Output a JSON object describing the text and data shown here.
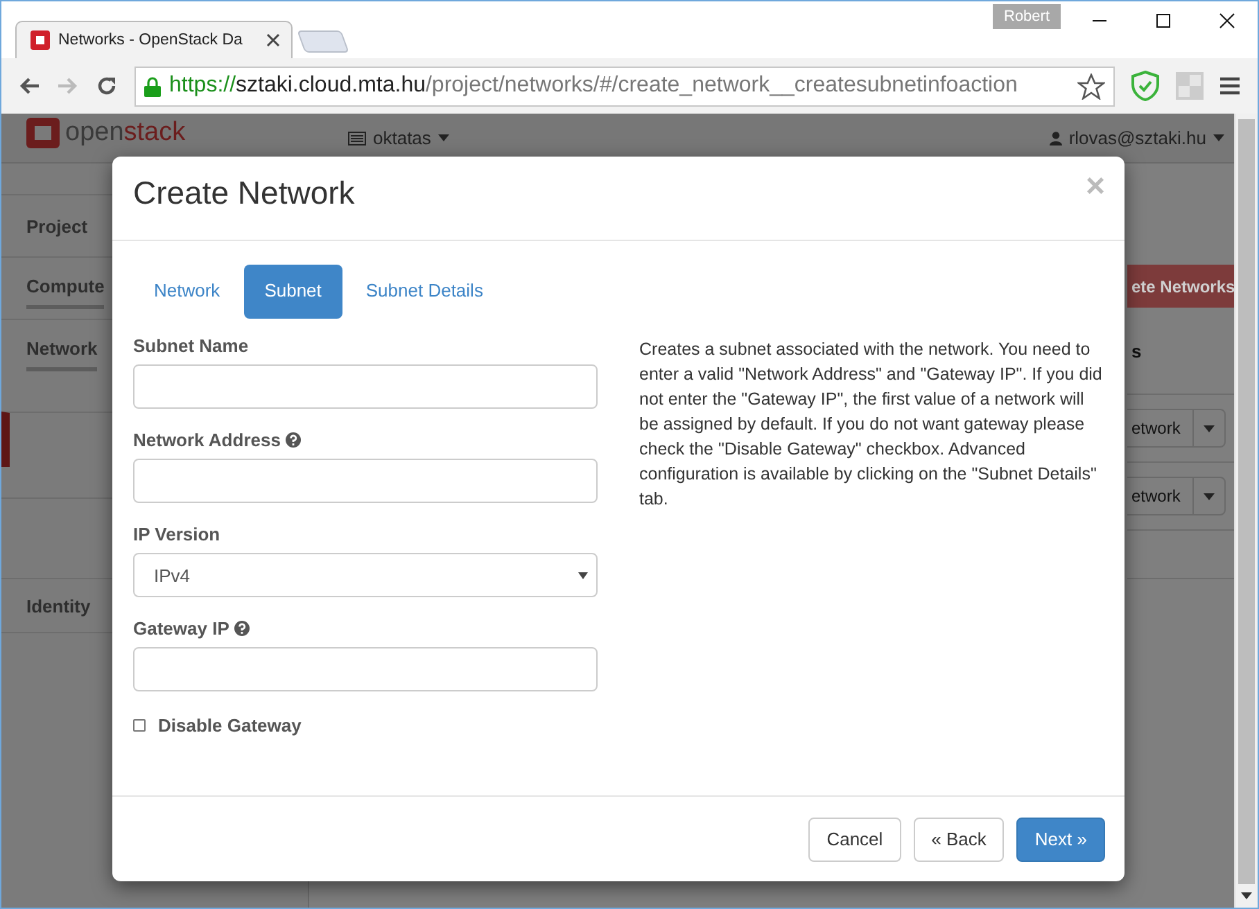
{
  "browser": {
    "tab_title": "Networks - OpenStack Da",
    "profile": "Robert",
    "url": {
      "scheme": "https://",
      "host": "sztaki.cloud.mta.hu",
      "path": "/project/networks/#/create_network__createsubnetinfoaction"
    }
  },
  "header": {
    "logo": [
      "open",
      "stack"
    ],
    "project": "oktatas",
    "user": "rlovas@sztaki.hu"
  },
  "sidebar": {
    "items": [
      {
        "label": "Project",
        "kind": "section",
        "selected": false
      },
      {
        "label": "Compute",
        "kind": "section",
        "selected": false
      },
      {
        "label": "Network",
        "kind": "section",
        "selected": false
      },
      {
        "kind": "blank",
        "selected": true
      },
      {
        "kind": "blank",
        "selected": false
      },
      {
        "label": "Identity",
        "kind": "section",
        "selected": false
      }
    ]
  },
  "background": {
    "action_button": "ete Networks",
    "heading": "s",
    "row_buttons": [
      "etwork",
      "etwork"
    ]
  },
  "modal": {
    "title": "Create Network",
    "close": "×",
    "tabs": [
      {
        "label": "Network",
        "selected": false
      },
      {
        "label": "Subnet",
        "selected": true
      },
      {
        "label": "Subnet Details",
        "selected": false
      }
    ],
    "fields": [
      {
        "kind": "text",
        "label": "Subnet Name",
        "help": false
      },
      {
        "kind": "text",
        "label": "Network Address",
        "help": true
      },
      {
        "kind": "select",
        "label": "IP Version",
        "help": false,
        "value": "IPv4"
      },
      {
        "kind": "text",
        "label": "Gateway IP",
        "help": true
      },
      {
        "kind": "checkbox",
        "label": "Disable Gateway",
        "checked": false
      }
    ],
    "description": "Creates a subnet associated with the network. You need to enter a valid \"Network Address\" and \"Gateway IP\". If you did not enter the \"Gateway IP\", the first value of a network will be assigned by default. If you do not want gateway please check the \"Disable Gateway\" checkbox. Advanced configuration is available by clicking on the \"Subnet Details\" tab.",
    "buttons": [
      {
        "label": "Cancel",
        "kind": "default"
      },
      {
        "label": "« Back",
        "kind": "default"
      },
      {
        "label": "Next »",
        "kind": "primary"
      }
    ]
  }
}
